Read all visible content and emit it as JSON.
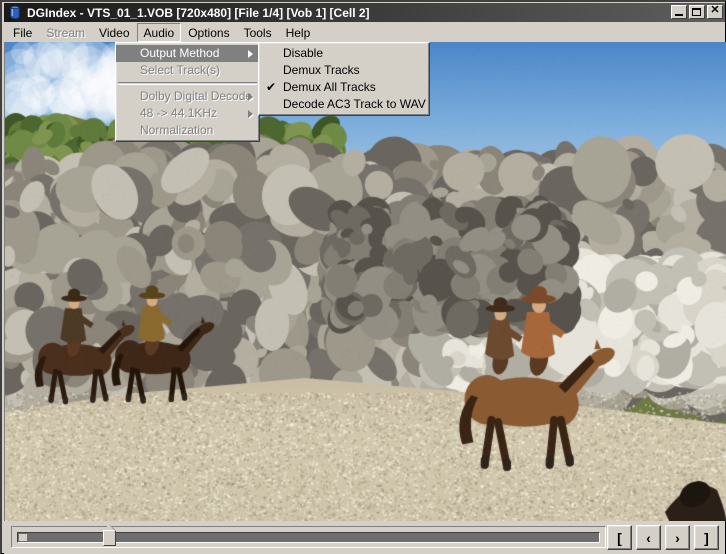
{
  "window": {
    "title": "DGIndex - VTS_01_1.VOB [720x480] [File 1/4] [Vob 1] [Cell 2]",
    "icon": "dgindex-app-icon",
    "controls": {
      "minimize": "minimize-icon",
      "maximize": "maximize-icon",
      "close": "✕"
    }
  },
  "menubar": {
    "items": [
      {
        "label": "File",
        "state": "normal"
      },
      {
        "label": "Stream",
        "state": "disabled"
      },
      {
        "label": "Video",
        "state": "normal"
      },
      {
        "label": "Audio",
        "state": "open"
      },
      {
        "label": "Options",
        "state": "normal"
      },
      {
        "label": "Tools",
        "state": "normal"
      },
      {
        "label": "Help",
        "state": "normal"
      }
    ]
  },
  "audio_menu": {
    "items": [
      {
        "label": "Output Method",
        "state": "highlight",
        "submenu": true,
        "checked": false
      },
      {
        "label": "Select Track(s)",
        "state": "disabled",
        "submenu": false,
        "checked": false
      },
      {
        "label": "---separator---",
        "state": "separator",
        "submenu": false,
        "checked": false
      },
      {
        "label": "Dolby Digital Decode",
        "state": "disabled",
        "submenu": true,
        "checked": false
      },
      {
        "label": "48 -> 44.1KHz",
        "state": "disabled",
        "submenu": true,
        "checked": false
      },
      {
        "label": "Normalization",
        "state": "disabled",
        "submenu": false,
        "checked": false
      }
    ]
  },
  "output_method_submenu": {
    "items": [
      {
        "label": "Disable",
        "state": "normal",
        "checked": false
      },
      {
        "label": "Demux Tracks",
        "state": "normal",
        "checked": false
      },
      {
        "label": "Demux All Tracks",
        "state": "normal",
        "checked": true
      },
      {
        "label": "Decode AC3 Track to WAV",
        "state": "normal",
        "checked": false
      }
    ],
    "checkmark": "✔"
  },
  "video_preview": {
    "description": "Western film frame: two riders on horseback in foreground on sandy ground, rocky hillside with green brush and blue sky behind",
    "resolution": "720x480"
  },
  "statusbar": {
    "trackbar": {
      "name": "frame-position-slider",
      "position_percent": 15,
      "min": 0,
      "max": 100
    },
    "nav_buttons": [
      {
        "label": "[",
        "name": "set-start-marker-button"
      },
      {
        "label": "‹",
        "name": "step-backward-button"
      },
      {
        "label": "›",
        "name": "step-forward-button"
      },
      {
        "label": "]",
        "name": "set-end-marker-button"
      }
    ]
  },
  "colors": {
    "face": "#d4d0c8",
    "menu_highlight": "#808080",
    "title_gradient_start": "#1a1a1a",
    "title_gradient_end": "#5e5e5e",
    "disabled_text": "#808080"
  }
}
